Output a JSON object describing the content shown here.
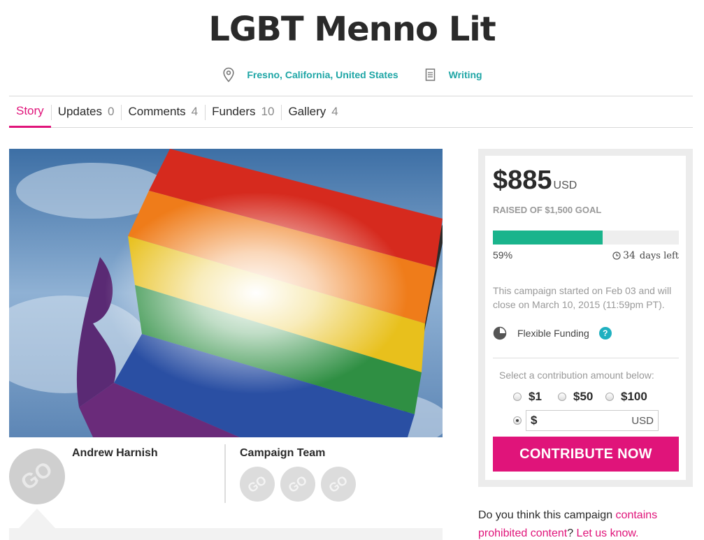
{
  "campaign": {
    "title": "LGBT Menno Lit",
    "location": "Fresno, California, United States",
    "category": "Writing"
  },
  "tabs": [
    {
      "label": "Story",
      "count": ""
    },
    {
      "label": "Updates",
      "count": "0"
    },
    {
      "label": "Comments",
      "count": "4"
    },
    {
      "label": "Funders",
      "count": "10"
    },
    {
      "label": "Gallery",
      "count": "4"
    }
  ],
  "owner": {
    "name": "Andrew Harnish",
    "team_label": "Campaign Team",
    "avatar_text": "GO"
  },
  "funding": {
    "amount": "$885",
    "currency": "USD",
    "raised_text": "RAISED OF $1,500 GOAL",
    "progress_fraction": 0.59,
    "percent_label": "59%",
    "days_left": "34",
    "days_label": "days left",
    "description": "This campaign started on Feb 03 and will close on March 10, 2015 (11:59pm PT).",
    "funding_type": "Flexible Funding",
    "help_glyph": "?",
    "select_label": "Select a contribution amount below:",
    "options": [
      "$1",
      "$50",
      "$100"
    ],
    "custom_prefix": "$",
    "custom_currency": "USD",
    "cta_label": "CONTRIBUTE NOW"
  },
  "report": {
    "prefix": "Do you think this campaign ",
    "link1": "contains prohibited content",
    "mid": "? ",
    "link2": "Let us know."
  },
  "colors": {
    "accent": "#e0147a",
    "teal": "#1fa6a6",
    "progress": "#1ab48c"
  },
  "icons": {
    "location": "location-pin-icon",
    "category": "document-icon",
    "clock": "clock-icon",
    "funding": "pie-chart-icon",
    "help": "question-icon"
  }
}
